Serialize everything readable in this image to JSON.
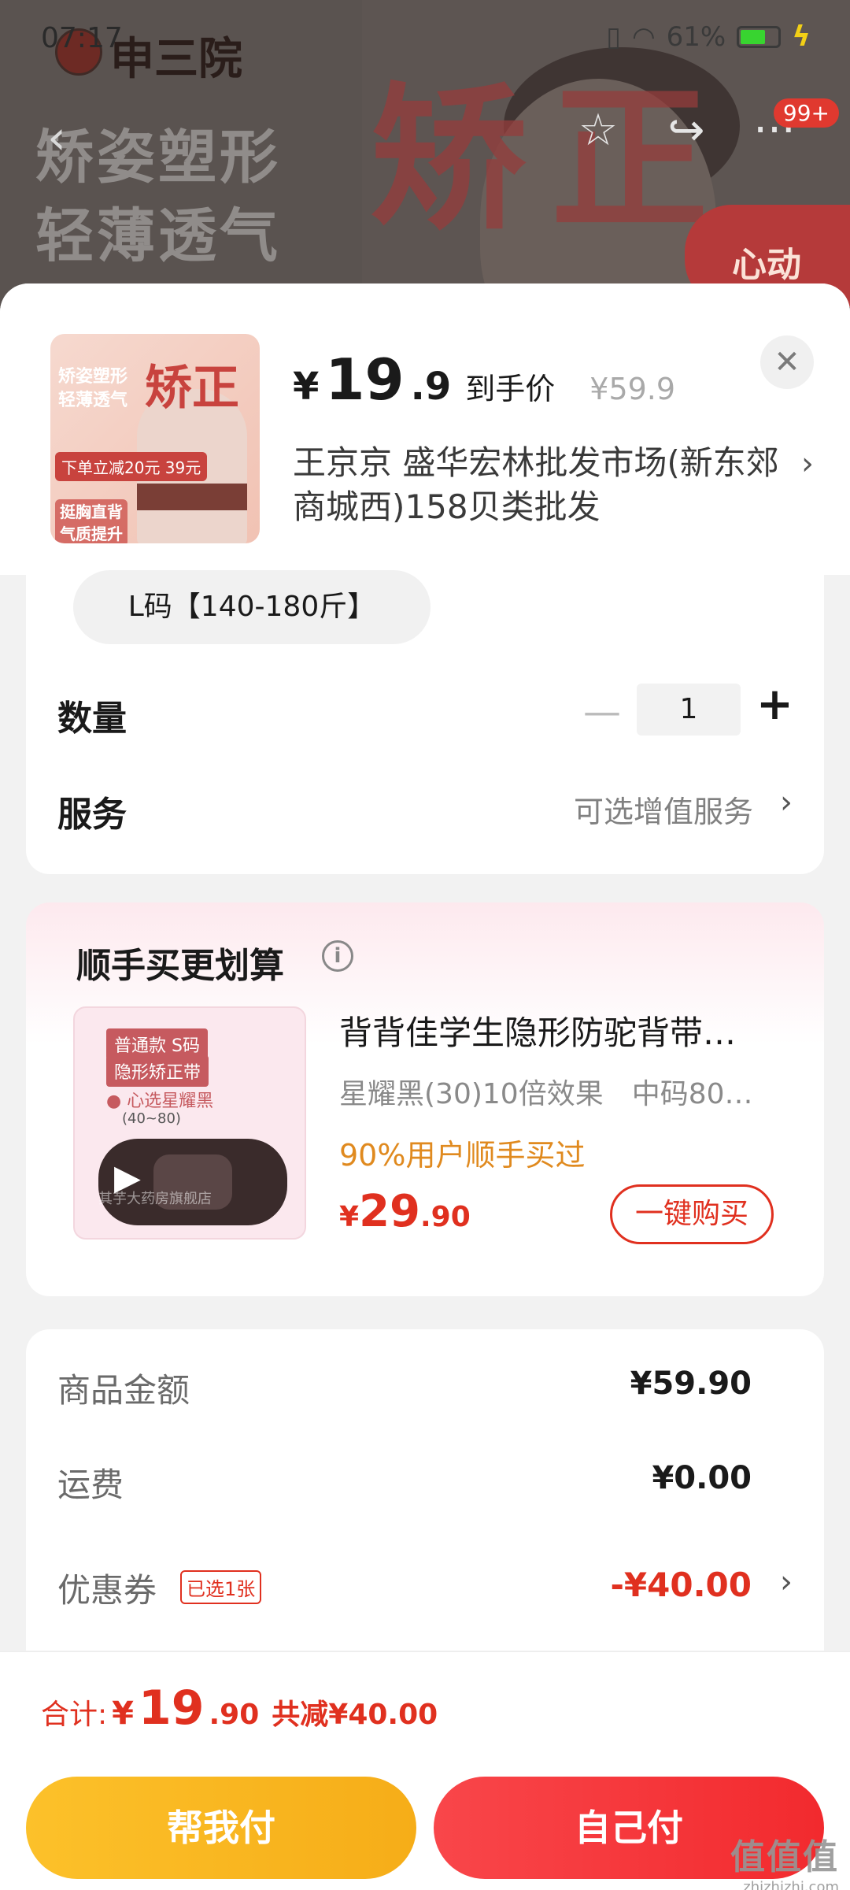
{
  "status_bar": {
    "time": "07:17",
    "battery": "61%"
  },
  "background": {
    "brand": "申三院",
    "slogan_line1": "矫姿塑形",
    "slogan_line2": "轻薄透气",
    "big_text": "矫正",
    "badge": "心动",
    "message_count": "99+"
  },
  "product": {
    "thumb_big": "矫正",
    "thumb_text": "矫姿塑形\n轻薄透气",
    "thumb_price": "下单立减20元 39元",
    "thumb_bottom": "挺胸直背\n气质提升",
    "price_symbol": "¥",
    "price_int": "19",
    "price_dec": ".9",
    "price_label": "到手价",
    "original_price": "¥59.9",
    "shop_name": "王京京  盛华宏林批发市场(新东郊商城西)158贝类批发"
  },
  "options": {
    "size_chip": "L码【140-180斤】",
    "quantity_label": "数量",
    "quantity_value": "1",
    "service_label": "服务",
    "service_value": "可选增值服务"
  },
  "bundle": {
    "title": "顺手买更划算",
    "thumb_tag1": "普通款 S码",
    "thumb_tag2": "隐形矫正带",
    "thumb_bullet": "● 心选星耀黑",
    "thumb_range": "(40~80)",
    "thumb_watermark": "其芋大药房旗舰店",
    "name": "背背佳学生隐形防驼背带…",
    "spec1": "星耀黑(30)10倍效果",
    "spec2": "中码80…",
    "promo": "90%用户顺手买过",
    "price_symbol": "¥",
    "price_int": "29",
    "price_dec": ".90",
    "buy_label": "一键购买"
  },
  "amounts": {
    "goods_label": "商品金额",
    "goods_value": "¥59.90",
    "shipping_label": "运费",
    "shipping_value": "¥0.00",
    "coupon_label": "优惠券",
    "coupon_tag": "已选1张",
    "coupon_value": "-¥40.00"
  },
  "footer": {
    "total_label": "合计:",
    "total_symbol": "¥",
    "total_int": "19",
    "total_dec": ".90",
    "total_save": "共减¥40.00",
    "help_pay": "帮我付",
    "self_pay": "自己付"
  },
  "watermark": {
    "main": "值值值",
    "sub": "zhizhizhi.com"
  },
  "colors": {
    "accent_red": "#e0301f",
    "orange": "#e08a1f",
    "help_button": "#fcc12a",
    "self_button": "#f22a2e"
  }
}
